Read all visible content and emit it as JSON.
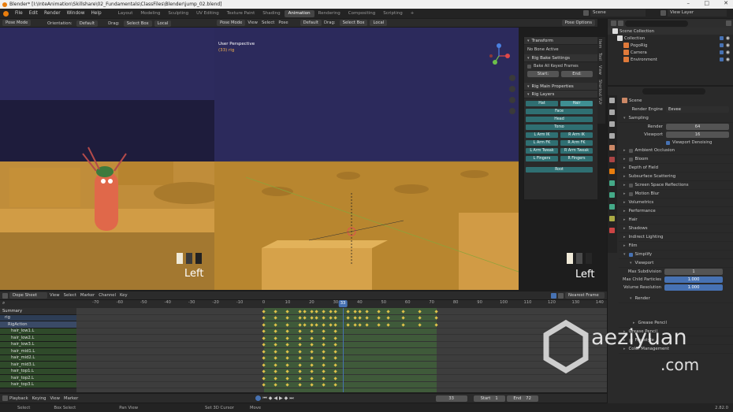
{
  "window": {
    "title": "Blender* [I:\\InteAnimation\\Skillshare\\02_Fundamentals\\ClassFiles\\Blender\\jump_02.blend]",
    "controls": [
      "–",
      "□",
      "✕"
    ]
  },
  "menubar": {
    "menus": [
      "File",
      "Edit",
      "Render",
      "Window",
      "Help"
    ],
    "workspaces": [
      "Layout",
      "Modeling",
      "Sculpting",
      "UV Editing",
      "Texture Paint",
      "Shading",
      "Animation",
      "Rendering",
      "Compositing",
      "Scripting"
    ],
    "active_workspace": "Animation",
    "add_tab": "+",
    "scene_label": "Scene",
    "view_layer_label": "View Layer"
  },
  "viewport_header": {
    "left_mode": "Pose Mode",
    "orientation_label": "Orientation:",
    "orientation_value": "Default",
    "drag_label": "Drag:",
    "drag_value": "Select Box",
    "pivot": "Local",
    "right_mode": "Pose Mode",
    "menus": [
      "View",
      "Select",
      "Pose"
    ],
    "right_orientation": "Default",
    "right_drag": "Select Box",
    "right_pivot": "Local",
    "pose_options": "Pose Options"
  },
  "viewport_main": {
    "view_name": "User Perspective",
    "object_info": "(33) rig",
    "left_view_label": "Left",
    "right_view_label": "Left",
    "gizmo_axes": [
      "X",
      "Y",
      "Z"
    ]
  },
  "npanel": {
    "tabs": [
      "Item",
      "Tool",
      "View",
      "Shortcut VUr"
    ],
    "transform_header": "Transform",
    "no_bone": "No Bone Active",
    "rig_bake_header": "Rig Bake Settings",
    "bake_all": "Bake All Keyed Frames",
    "start_label": "Start:",
    "start_value": "",
    "end_label": "End:",
    "end_value": "",
    "rig_main_header": "Rig Main Properties",
    "rig_layers_header": "Rig Layers",
    "layer_buttons": [
      [
        "Hat",
        "Hair"
      ],
      [
        "Face"
      ],
      [
        "Head"
      ],
      [
        "Torso"
      ],
      [
        "L Arm IK",
        "R Arm IK"
      ],
      [
        "L Arm FK",
        "R Arm FK"
      ],
      [
        "L Arm Tweak",
        "R Arm Tweak"
      ],
      [
        "L Fingers",
        "R Fingers"
      ],
      [
        "Root"
      ]
    ]
  },
  "outliner": {
    "search_placeholder": "",
    "root": "Scene Collection",
    "items": [
      {
        "label": "Collection",
        "indent": 1
      },
      {
        "label": "PogoRig",
        "indent": 2
      },
      {
        "label": "Camera",
        "indent": 2
      },
      {
        "label": "Environment",
        "indent": 2
      }
    ]
  },
  "properties": {
    "search_placeholder": "",
    "scene_label": "Scene",
    "render_engine_label": "Render Engine",
    "render_engine_value": "Eevee",
    "sampling_header": "Sampling",
    "render_samples_label": "Render",
    "render_samples_value": "64",
    "viewport_samples_label": "Viewport",
    "viewport_samples_value": "16",
    "viewport_denoising": "Viewport Denoising",
    "panels": [
      "Ambient Occlusion",
      "Bloom",
      "Depth of Field",
      "Subsurface Scattering",
      "Screen Space Reflections",
      "Motion Blur",
      "Volumetrics",
      "Performance",
      "Hair",
      "Shadows",
      "Indirect Lighting",
      "Film"
    ],
    "checkbox_panels": [
      "Ambient Occlusion",
      "Bloom",
      "Depth of Field",
      "Subsurface Scattering",
      "Screen Space Reflections",
      "Motion Blur"
    ],
    "simplify_header": "Simplify",
    "simplify_viewport_header": "Viewport",
    "max_subdivision_label": "Max Subdivision",
    "max_subdivision_value": "1",
    "max_child_particles_label": "Max Child Particles",
    "max_child_particles_value": "1.000",
    "volume_resolution_label": "Volume Resolution",
    "volume_resolution_value": "1.000",
    "simplify_render_header": "Render",
    "grease_pencil_sub": "Grease Pencil",
    "bottom_panels": [
      "Grease Pencil",
      "Freestyle",
      "Color Management"
    ]
  },
  "dopesheet": {
    "editor": "Dope Sheet",
    "menus": [
      "View",
      "Select",
      "Marker",
      "Channel",
      "Key"
    ],
    "snap_value": "Nearest Frame",
    "ruler_ticks": [
      "-70",
      "-60",
      "-50",
      "-40",
      "-30",
      "-20",
      "-10",
      "0",
      "10",
      "20",
      "30",
      "40",
      "50",
      "60",
      "70",
      "80",
      "90",
      "100",
      "110",
      "120",
      "130",
      "140"
    ],
    "current_frame": "33",
    "channels": [
      {
        "label": "Summary",
        "type": "summary"
      },
      {
        "label": "rig",
        "type": "object"
      },
      {
        "label": "RigAction",
        "type": "action"
      },
      {
        "label": "hair_low1.L",
        "type": "group"
      },
      {
        "label": "hair_low2.L",
        "type": "group"
      },
      {
        "label": "hair_low3.L",
        "type": "group"
      },
      {
        "label": "hair_mid1.L",
        "type": "group"
      },
      {
        "label": "hair_mid2.L",
        "type": "group"
      },
      {
        "label": "hair_mid3.L",
        "type": "group"
      },
      {
        "label": "hair_top1.L",
        "type": "group"
      },
      {
        "label": "hair_top2.L",
        "type": "group"
      },
      {
        "label": "hair_top3.L",
        "type": "group"
      }
    ],
    "keyframes": {
      "summary": [
        0,
        5,
        10,
        15,
        17,
        20,
        22,
        25,
        28,
        30,
        35,
        38,
        40,
        43,
        48,
        52,
        58,
        65,
        72
      ],
      "groups": [
        0,
        5,
        10,
        15,
        20,
        25,
        30
      ]
    }
  },
  "timeline": {
    "menus": [
      "Playback",
      "Keying",
      "View",
      "Marker"
    ],
    "current_frame": "33",
    "start_label": "Start",
    "start_value": "1",
    "end_label": "End",
    "end_value": "72"
  },
  "statusbar": {
    "items": [
      "Select",
      "Box Select",
      "Pan View",
      "Set 3D Cursor",
      "Move"
    ],
    "version": "2.82.0"
  },
  "watermark": {
    "text": "aeziyuan",
    "domain": ".com"
  }
}
